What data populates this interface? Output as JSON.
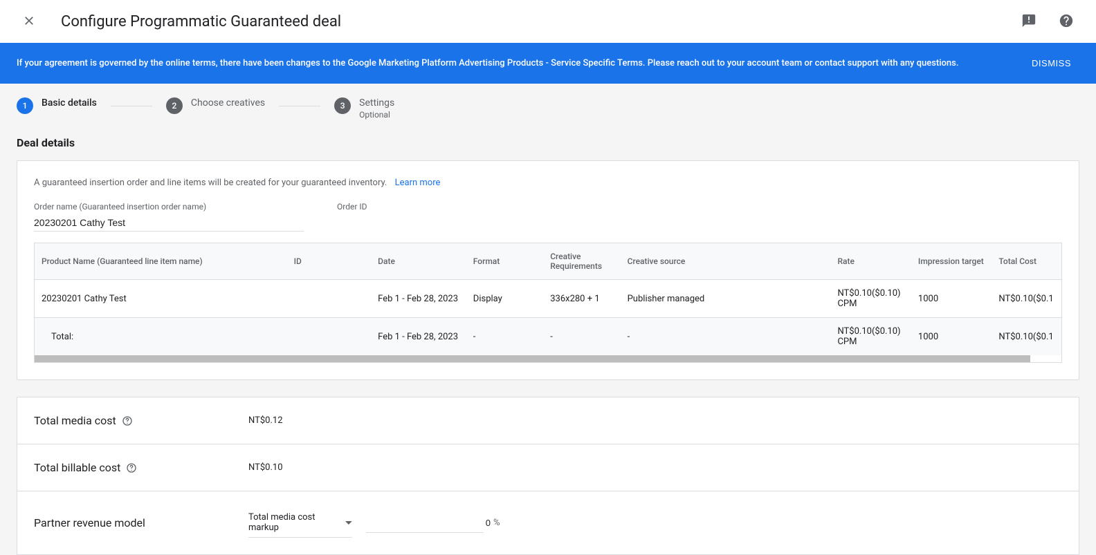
{
  "header": {
    "title": "Configure Programmatic Guaranteed deal"
  },
  "banner": {
    "text": "If your agreement is governed by the online terms, there have been changes to the Google Marketing Platform Advertising Products - Service Specific Terms. Please reach out to your account team or contact support with any questions.",
    "dismiss": "DISMISS"
  },
  "stepper": {
    "steps": [
      {
        "num": "1",
        "label": "Basic details"
      },
      {
        "num": "2",
        "label": "Choose creatives"
      },
      {
        "num": "3",
        "label": "Settings",
        "sub": "Optional"
      }
    ]
  },
  "section_title": "Deal details",
  "deal_card": {
    "intro": "A guaranteed insertion order and line items will be created for your guaranteed inventory.",
    "learn_more": "Learn more",
    "order_name_label": "Order name (Guaranteed insertion order name)",
    "order_name_value": "20230201 Cathy Test",
    "order_id_label": "Order ID",
    "order_id_value": "",
    "table": {
      "headers": [
        "Product Name (Guaranteed line item name)",
        "ID",
        "Date",
        "Format",
        "Creative Requirements",
        "Creative source",
        "Rate",
        "Impression target",
        "Total Cost"
      ],
      "rows": [
        {
          "name": "20230201 Cathy Test",
          "id": "",
          "date": "Feb 1 - Feb 28, 2023",
          "format": "Display",
          "creq": "336x280 + 1",
          "csrc": "Publisher managed",
          "rate": "NT$0.10($0.10) CPM",
          "target": "1000",
          "cost": "NT$0.10($0.1"
        }
      ],
      "total": {
        "name": "Total:",
        "id": "",
        "date": "Feb 1 - Feb 28, 2023",
        "format": "-",
        "creq": "-",
        "csrc": "-",
        "rate": "NT$0.10($0.10) CPM",
        "target": "1000",
        "cost": "NT$0.10($0.1"
      }
    }
  },
  "summary": {
    "media_cost_label": "Total media cost",
    "media_cost_value": "NT$0.12",
    "billable_cost_label": "Total billable cost",
    "billable_cost_value": "NT$0.10",
    "revenue_model_label": "Partner revenue model",
    "revenue_model_select": "Total media cost markup",
    "revenue_model_percent": "0"
  }
}
